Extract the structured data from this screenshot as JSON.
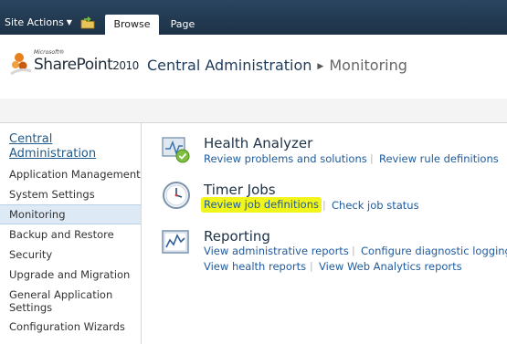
{
  "ribbon": {
    "site_actions": "Site Actions",
    "tabs": [
      {
        "label": "Browse",
        "selected": true
      },
      {
        "label": "Page",
        "selected": false
      }
    ]
  },
  "header": {
    "logo_microsoft": "Microsoft®",
    "logo_product": "SharePoint",
    "logo_version": "2010",
    "breadcrumb_root": "Central Administration",
    "breadcrumb_current": "Monitoring"
  },
  "leftnav": {
    "heading": "Central Administration",
    "items": [
      {
        "label": "Application Management",
        "selected": false
      },
      {
        "label": "System Settings",
        "selected": false
      },
      {
        "label": "Monitoring",
        "selected": true
      },
      {
        "label": "Backup and Restore",
        "selected": false
      },
      {
        "label": "Security",
        "selected": false
      },
      {
        "label": "Upgrade and Migration",
        "selected": false
      },
      {
        "label": "General Application Settings",
        "selected": false
      },
      {
        "label": "Configuration Wizards",
        "selected": false
      }
    ]
  },
  "sections": [
    {
      "title": "Health Analyzer",
      "icon": "health-analyzer-icon",
      "links": [
        "Review problems and solutions",
        "Review rule definitions"
      ]
    },
    {
      "title": "Timer Jobs",
      "icon": "clock-icon",
      "links": [
        "Review job definitions",
        "Check job status"
      ]
    },
    {
      "title": "Reporting",
      "icon": "report-chart-icon",
      "links": [
        "View administrative reports",
        "Configure diagnostic logging",
        "View health reports",
        "View Web Analytics reports"
      ]
    }
  ],
  "colors": {
    "ribbon_bg": "#21374c",
    "link": "#1f5a9e",
    "highlight": "#f2f519",
    "nav_selected": "#dde9f5"
  }
}
